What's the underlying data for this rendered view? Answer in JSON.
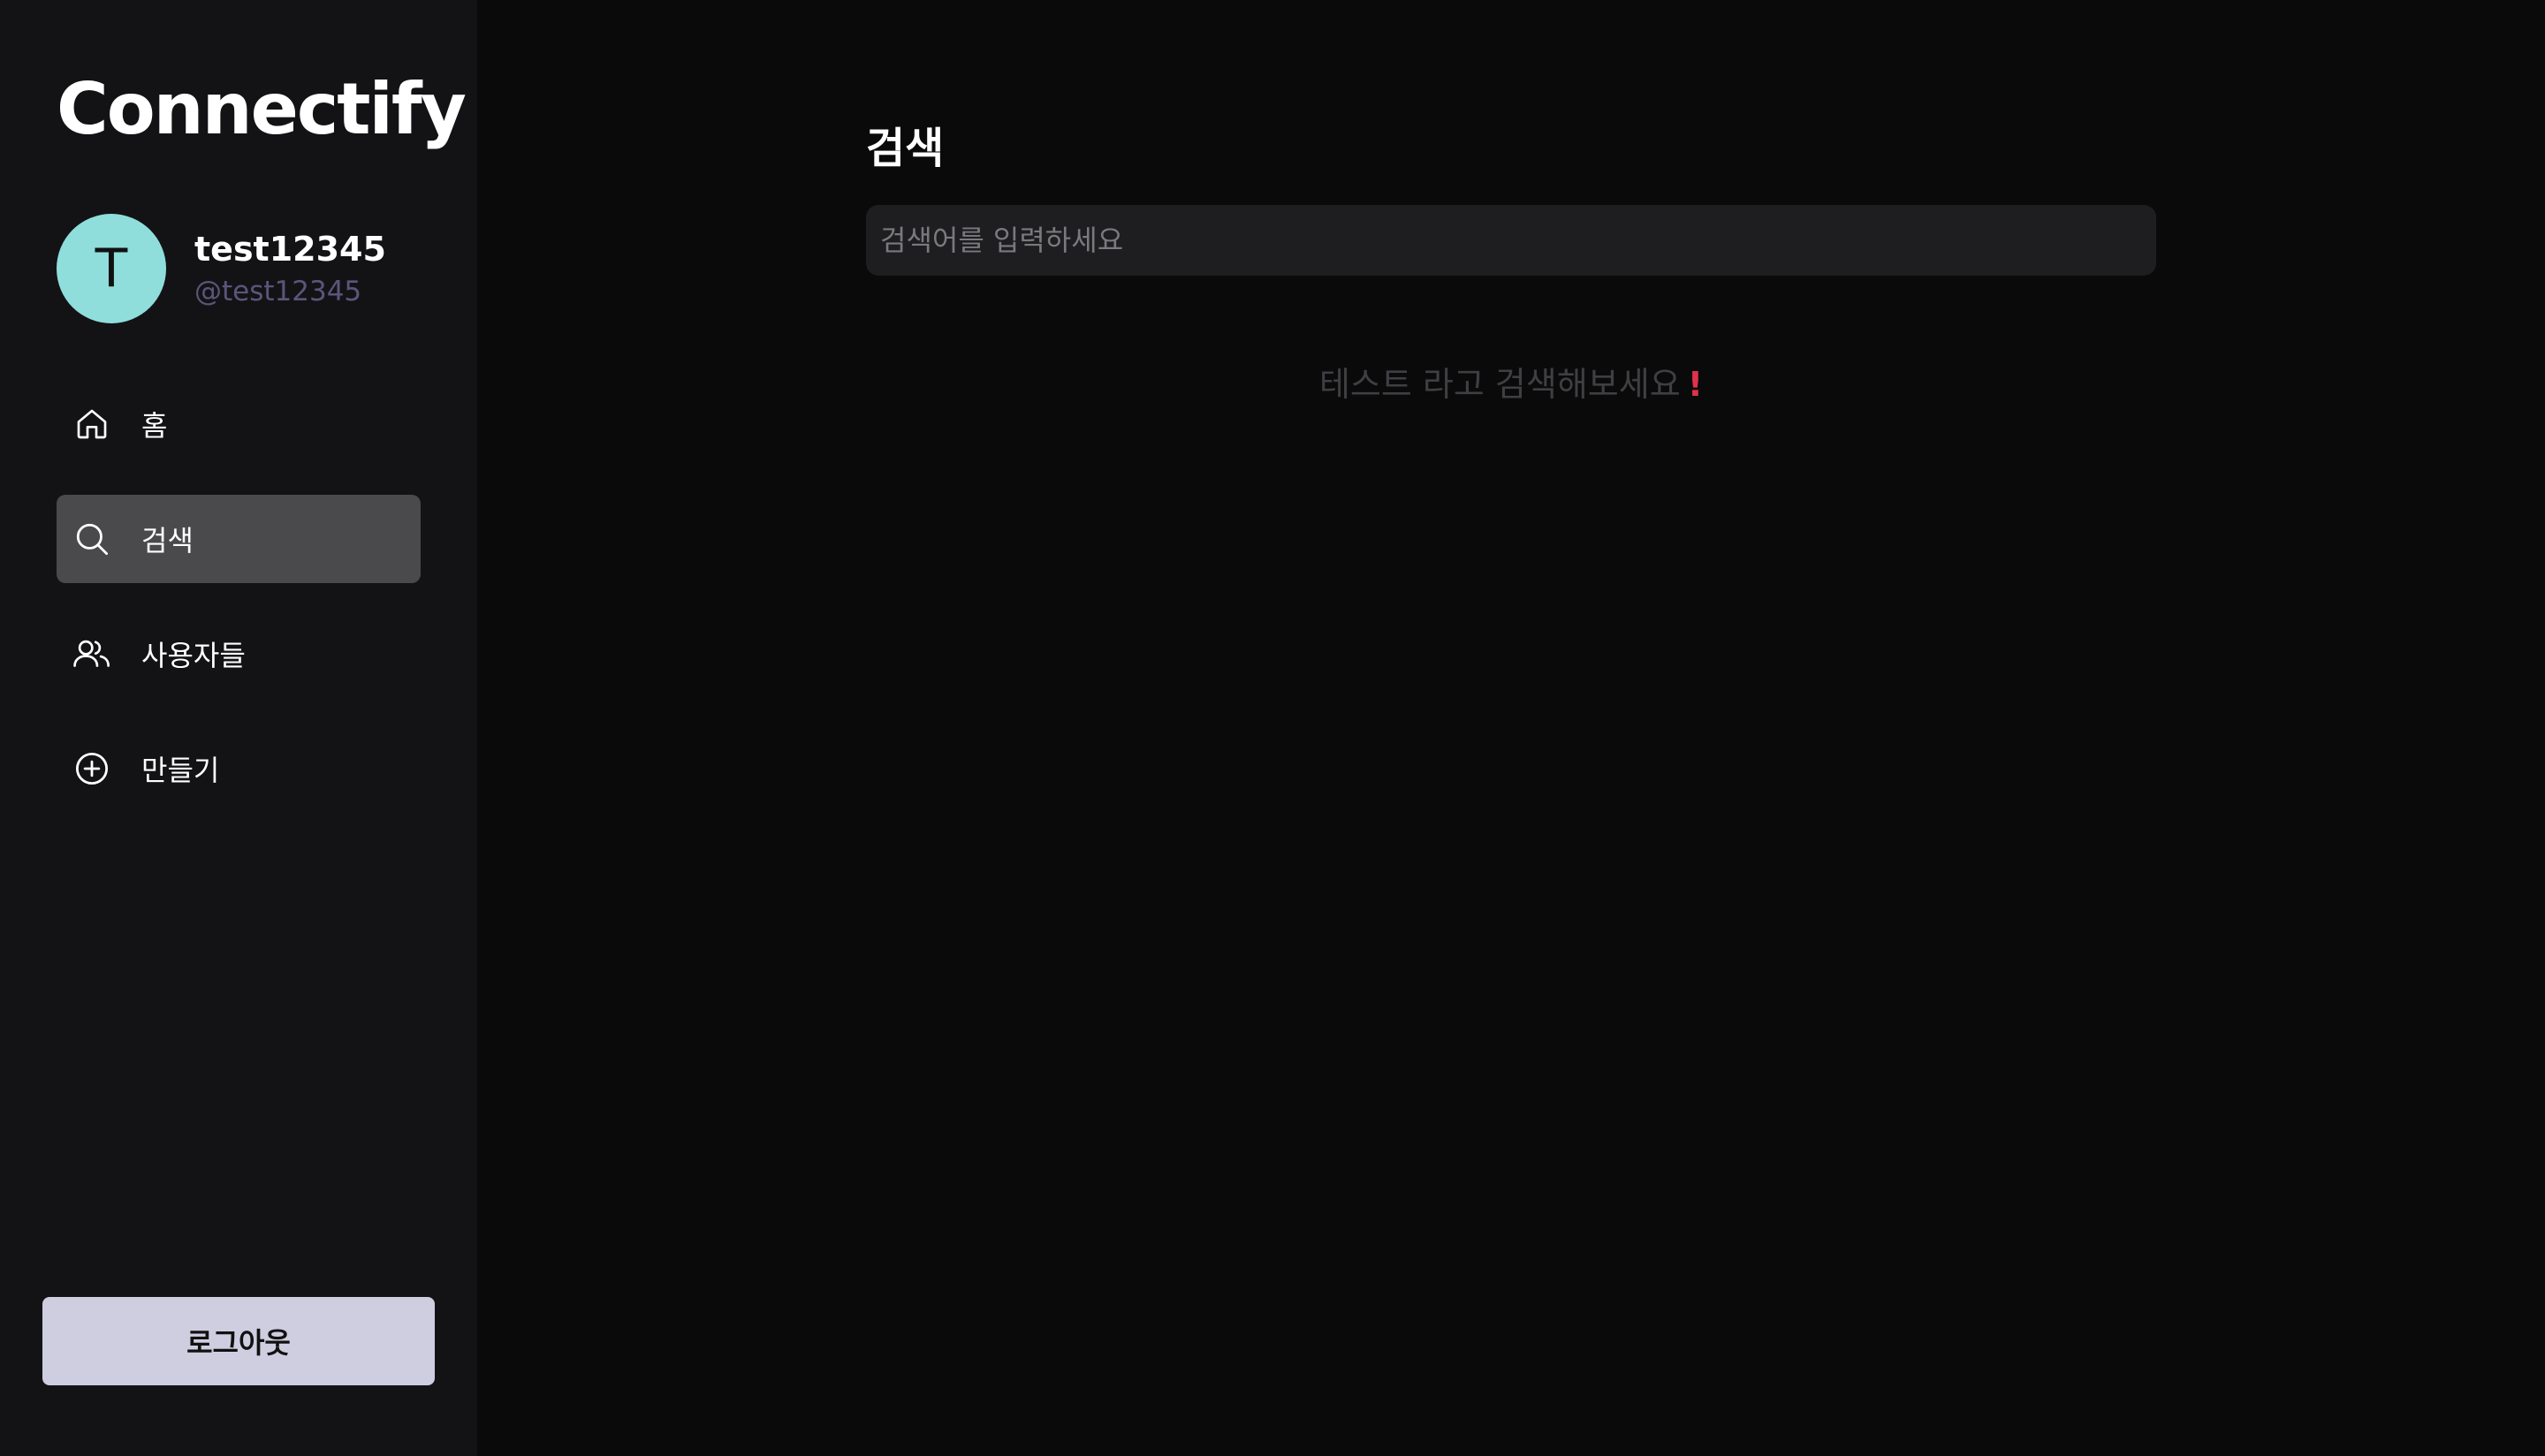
{
  "app": {
    "logo": "Connectify"
  },
  "profile": {
    "avatar_initial": "T",
    "avatar_color": "#8fdedb",
    "name": "test12345",
    "handle": "@test12345"
  },
  "nav": {
    "items": [
      {
        "label": "홈",
        "icon": "home-icon",
        "active": false
      },
      {
        "label": "검색",
        "icon": "search-icon",
        "active": true
      },
      {
        "label": "사용자들",
        "icon": "users-icon",
        "active": false
      },
      {
        "label": "만들기",
        "icon": "plus-circle-icon",
        "active": false
      }
    ]
  },
  "logout": {
    "label": "로그아웃"
  },
  "main": {
    "title": "검색",
    "search": {
      "placeholder": "검색어를 입력하세요",
      "value": ""
    },
    "hint": "테스트 라고 검색해보세요",
    "hint_emoji": "!"
  },
  "colors": {
    "background": "#0a0a0b",
    "sidebar": "#131316",
    "active_nav": "#4a4a4d",
    "logout_button": "#cfcde0",
    "accent_red": "#e0324b",
    "handle": "#5c557a"
  }
}
